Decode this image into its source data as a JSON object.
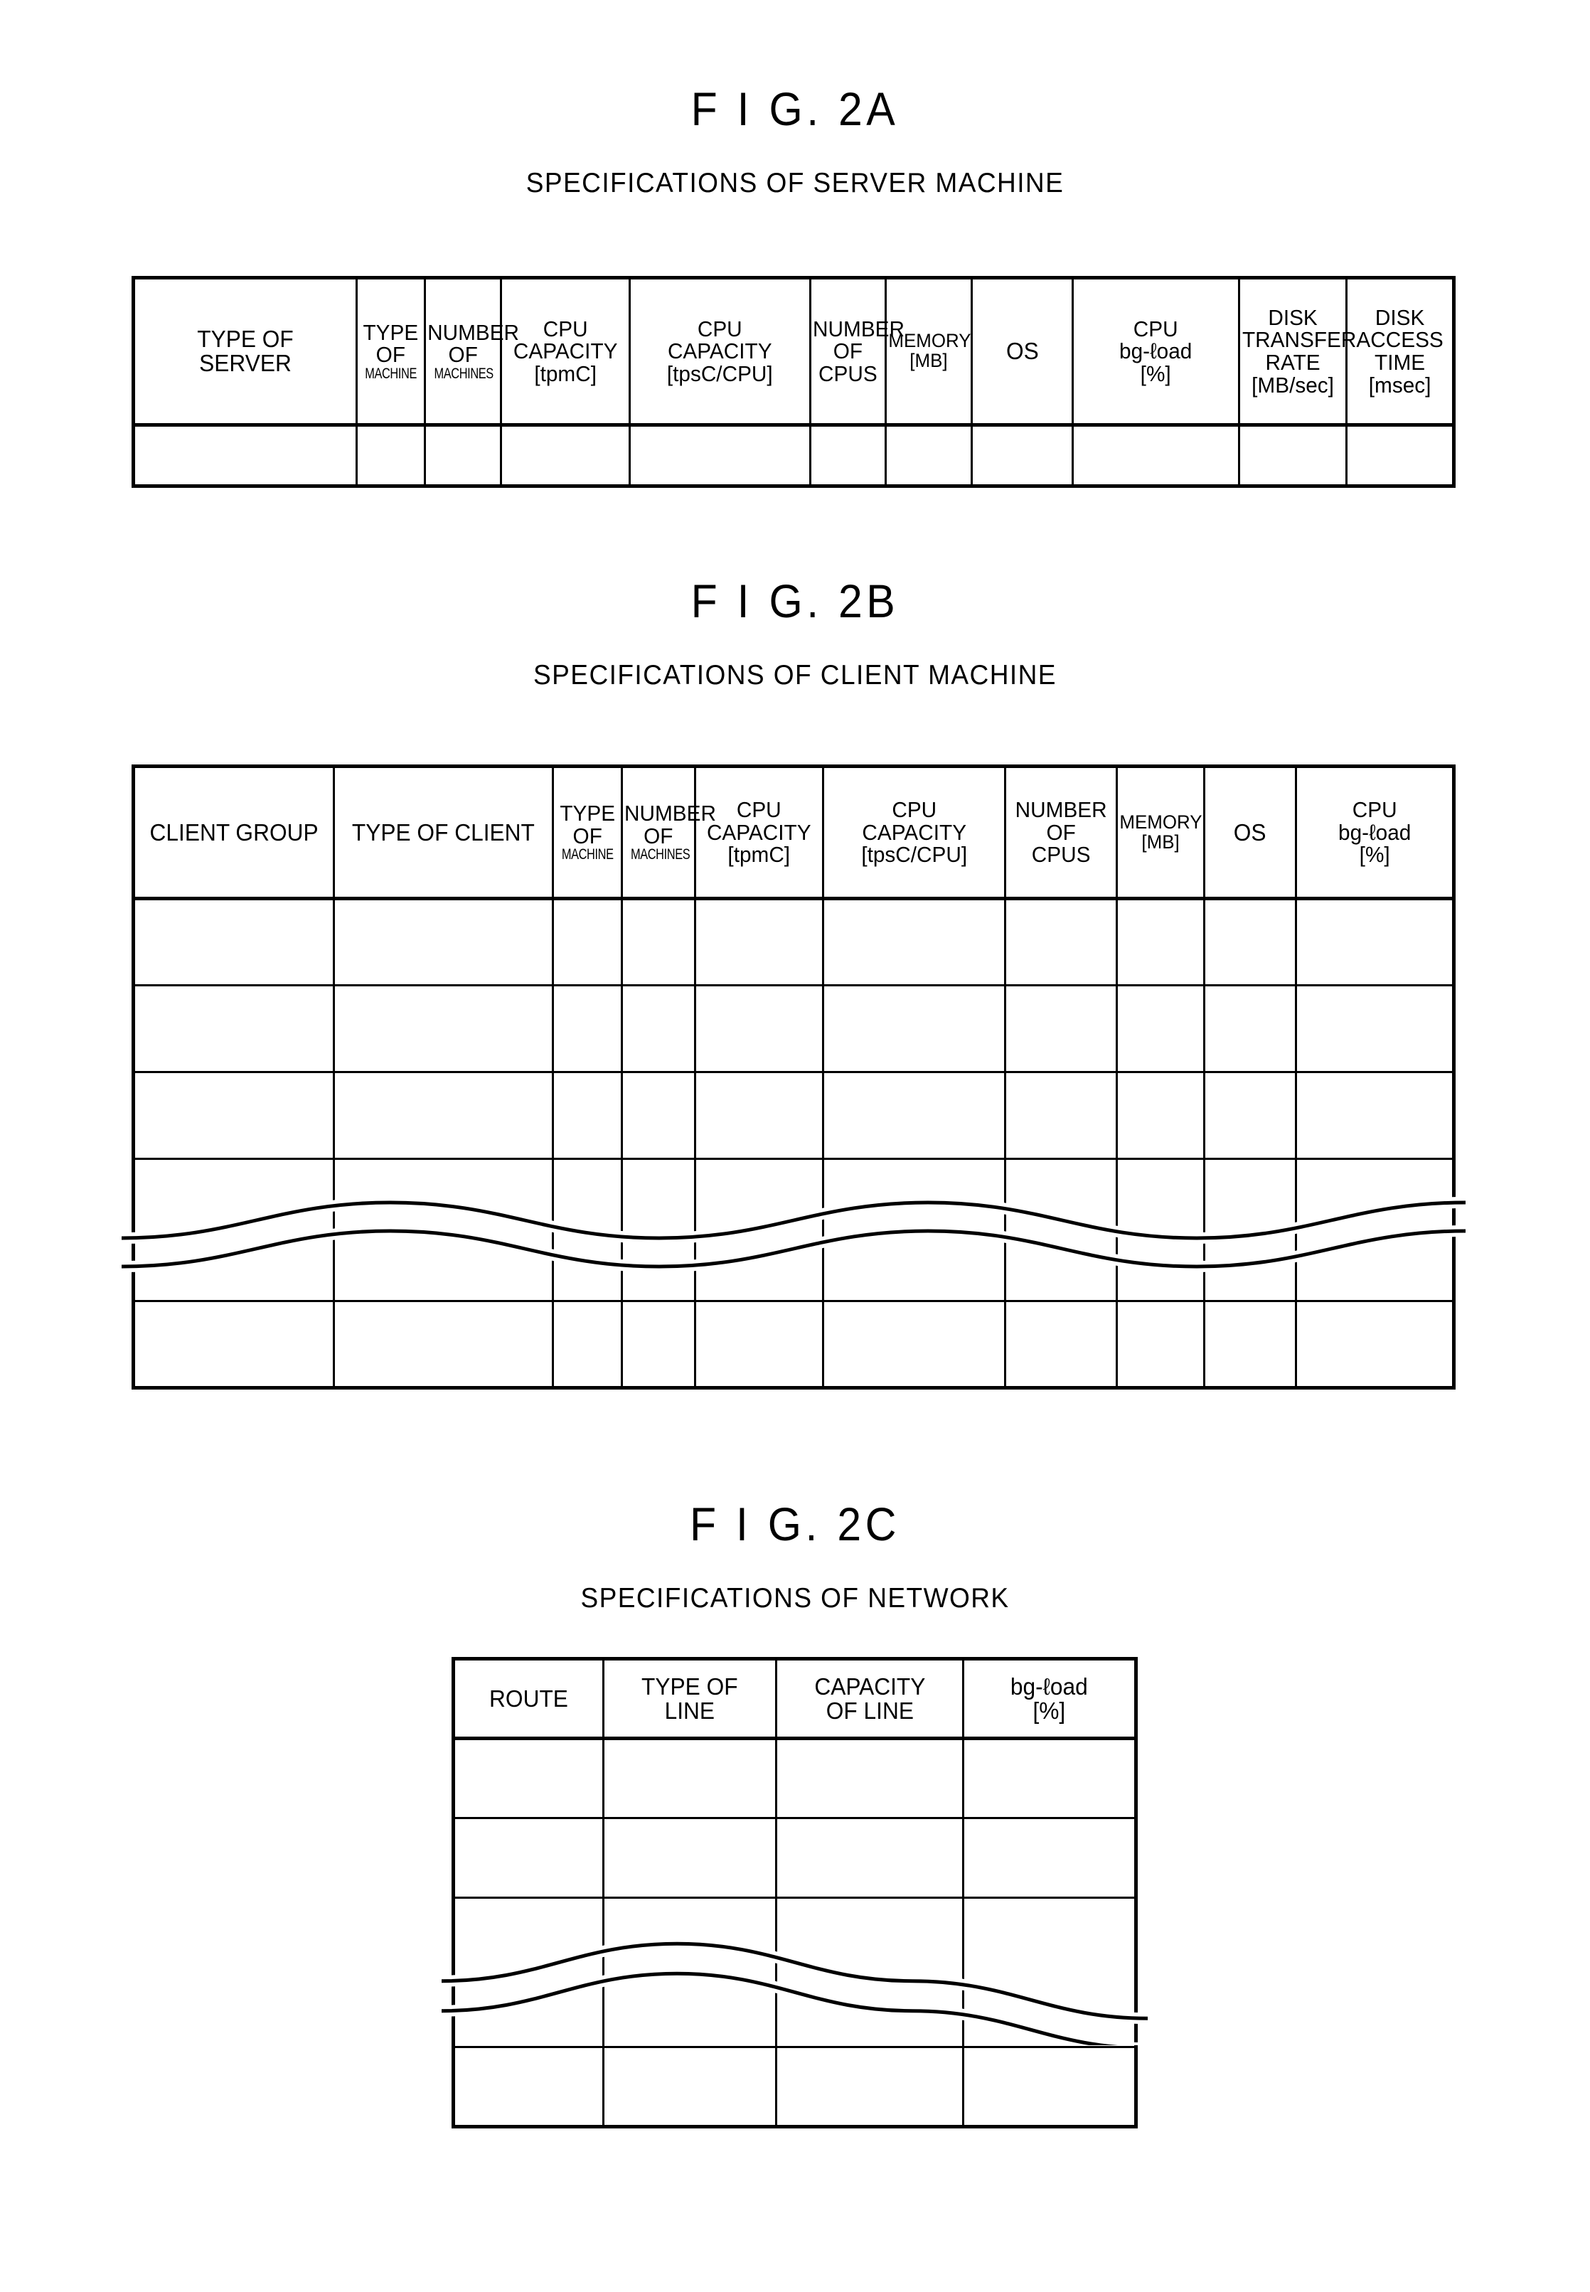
{
  "figures": [
    {
      "id": "fig-2a",
      "title": "F I G. 2A",
      "subtitle": "SPECIFICATIONS OF SERVER MACHINE",
      "columns": [
        {
          "label": "TYPE OF\nSERVER",
          "size": "lg",
          "width": 187
        },
        {
          "label": "TYPE\nOF\nMACHINE",
          "size": "mix_machine",
          "width": 57
        },
        {
          "label": "NUMBER\nOF\nMACHINES",
          "size": "mix_machines",
          "width": 64
        },
        {
          "label": "CPU\nCAPACITY\n[tpmC]",
          "size": "md",
          "width": 108
        },
        {
          "label": "CPU\nCAPACITY\n[tpsC/CPU]",
          "size": "md",
          "width": 151
        },
        {
          "label": "NUMBER\nOF\nCPUS",
          "size": "md",
          "width": 63
        },
        {
          "label": "MEMORY\n[MB]",
          "size": "sm",
          "width": 72
        },
        {
          "label": "OS",
          "size": "lg",
          "width": 85
        },
        {
          "label": "CPU\nbg-ℓoad\n[%]",
          "size": "md",
          "width": 139
        },
        {
          "label": "DISK\nTRANSFER\nRATE\n[MB/sec]",
          "size": "md",
          "width": 90
        },
        {
          "label": "DISK\nACCESS\nTIME\n[msec]",
          "size": "md",
          "width": 90
        }
      ],
      "body_rows": 1,
      "wave_after_row": null
    },
    {
      "id": "fig-2b",
      "title": "F I G. 2B",
      "subtitle": "SPECIFICATIONS OF CLIENT MACHINE",
      "columns": [
        {
          "label": "CLIENT GROUP",
          "size": "lg",
          "width": 165
        },
        {
          "label": "TYPE OF CLIENT",
          "size": "lg",
          "width": 180
        },
        {
          "label": "TYPE\nOF\nMACHINE",
          "size": "mix_machine",
          "width": 57
        },
        {
          "label": "NUMBER\nOF\nMACHINES",
          "size": "mix_machines",
          "width": 60
        },
        {
          "label": "CPU\nCAPACITY\n[tpmC]",
          "size": "md",
          "width": 105
        },
        {
          "label": "CPU\nCAPACITY\n[tpsC/CPU]",
          "size": "md",
          "width": 150
        },
        {
          "label": "NUMBER\nOF\nCPUS",
          "size": "md",
          "width": 92
        },
        {
          "label": "MEMORY\n[MB]",
          "size": "sm",
          "width": 72
        },
        {
          "label": "OS",
          "size": "lg",
          "width": 75
        },
        {
          "label": "CPU\nbg-ℓoad\n[%]",
          "size": "md",
          "width": 130
        }
      ],
      "body_rows": 5,
      "wave_after_row": 3
    },
    {
      "id": "fig-2c",
      "title": "F I G. 2C",
      "subtitle": "SPECIFICATIONS OF NETWORK",
      "columns": [
        {
          "label": "ROUTE",
          "size": "lg",
          "width": 100
        },
        {
          "label": "TYPE OF\nLINE",
          "size": "lg",
          "width": 115
        },
        {
          "label": "CAPACITY\nOF LINE",
          "size": "lg",
          "width": 125
        },
        {
          "label": "bg-ℓoad\n[%]",
          "size": "lg",
          "width": 115
        }
      ],
      "body_rows": 4,
      "wave_after_row": 2
    }
  ],
  "colors": {
    "ink": "#000000",
    "paper": "#ffffff"
  }
}
